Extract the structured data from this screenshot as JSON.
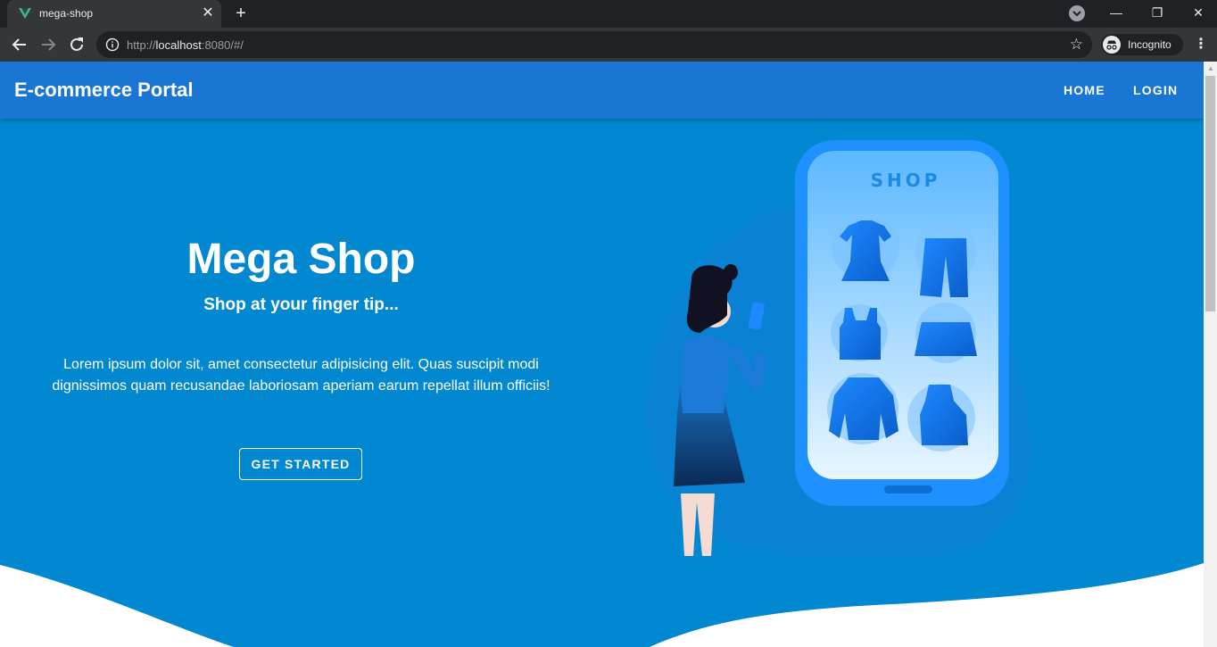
{
  "browser": {
    "tab_title": "mega-shop",
    "tab_close": "✕",
    "new_tab": "+",
    "url_prefix": "http://",
    "url_host": "localhost",
    "url_rest": ":8080/#/",
    "profile_label": "Incognito",
    "window_controls": {
      "minimize": "—",
      "restore": "❐",
      "close": "✕"
    }
  },
  "app": {
    "title": "E-commerce Portal",
    "nav": [
      {
        "label": "HOME"
      },
      {
        "label": "LOGIN"
      }
    ]
  },
  "hero": {
    "title": "Mega Shop",
    "subtitle": "Shop at your finger tip...",
    "body": "Lorem ipsum dolor sit, amet consectetur adipisicing elit. Quas suscipit modi dignissimos quam recusandae laboriosam aperiam earum repellat illum officiis!",
    "cta_label": "GET STARTED"
  },
  "illustration": {
    "screen_label": "SHOP"
  },
  "colors": {
    "app_bar": "#1976d2",
    "hero_bg": "#0288d1",
    "accent": "#2196f3"
  }
}
